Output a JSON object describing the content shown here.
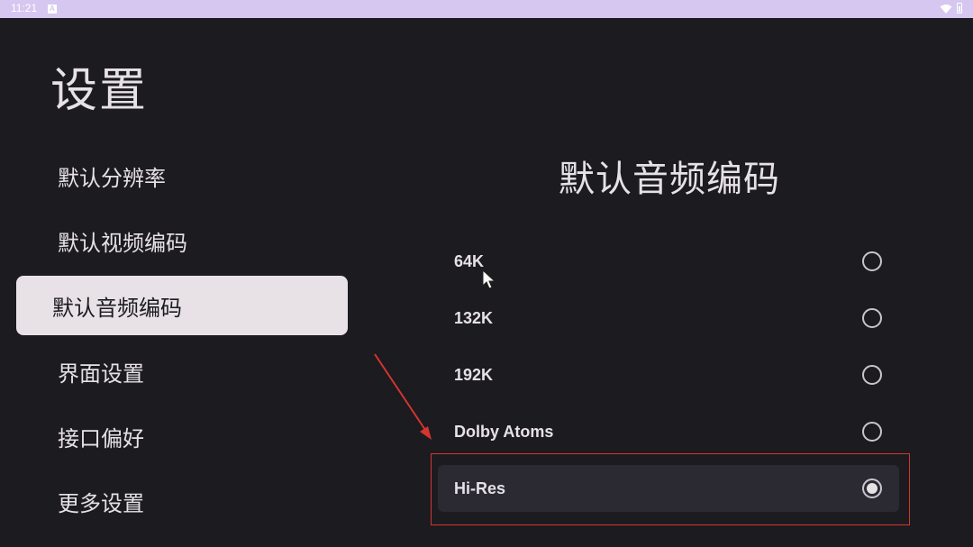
{
  "status_bar": {
    "time": "11:21",
    "notification_glyph": "A",
    "icons": [
      "wifi-icon",
      "battery-icon"
    ]
  },
  "page": {
    "title": "设置"
  },
  "sidebar": {
    "items": [
      {
        "label": "默认分辨率",
        "active": false
      },
      {
        "label": "默认视频编码",
        "active": false
      },
      {
        "label": "默认音频编码",
        "active": true
      },
      {
        "label": "界面设置",
        "active": false
      },
      {
        "label": "接口偏好",
        "active": false
      },
      {
        "label": "更多设置",
        "active": false
      }
    ]
  },
  "panel": {
    "title": "默认音频编码",
    "options": [
      {
        "label": "64K",
        "selected": false
      },
      {
        "label": "132K",
        "selected": false
      },
      {
        "label": "192K",
        "selected": false
      },
      {
        "label": "Dolby Atoms",
        "selected": false
      },
      {
        "label": "Hi-Res",
        "selected": true
      }
    ]
  },
  "colors": {
    "background": "#1c1b1f",
    "status_bar": "#d5c7f0",
    "active_nav": "#e8e2e7",
    "selected_row": "#2b2a33",
    "annotation_red": "#d4352f"
  }
}
